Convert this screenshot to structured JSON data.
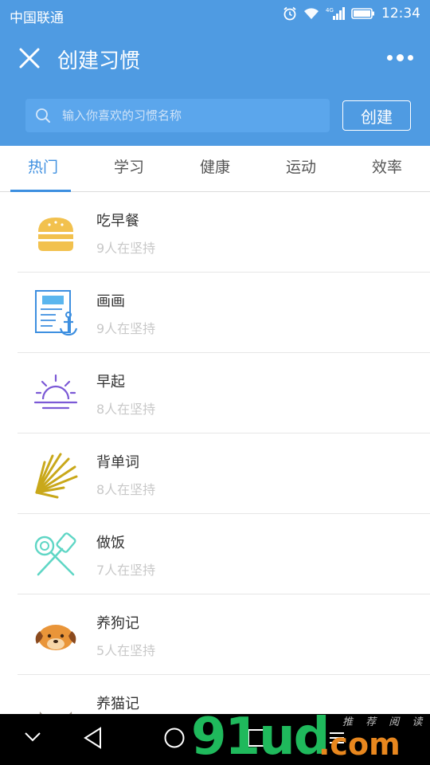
{
  "status_bar": {
    "carrier": "中国联通",
    "network": "4G",
    "time": "12:34"
  },
  "header": {
    "title": "创建习惯",
    "search_placeholder": "输入你喜欢的习惯名称",
    "create_label": "创建"
  },
  "tabs": [
    {
      "label": "热门",
      "active": true
    },
    {
      "label": "学习",
      "active": false
    },
    {
      "label": "健康",
      "active": false
    },
    {
      "label": "运动",
      "active": false
    },
    {
      "label": "效率",
      "active": false
    }
  ],
  "habits": [
    {
      "name": "吃早餐",
      "count": "9人在坚持",
      "icon": "burger-icon"
    },
    {
      "name": "画画",
      "count": "9人在坚持",
      "icon": "drawing-board-icon"
    },
    {
      "name": "早起",
      "count": "8人在坚持",
      "icon": "sunrise-icon"
    },
    {
      "name": "背单词",
      "count": "8人在坚持",
      "icon": "burst-icon"
    },
    {
      "name": "做饭",
      "count": "7人在坚持",
      "icon": "cooking-utensils-icon"
    },
    {
      "name": "养狗记",
      "count": "5人在坚持",
      "icon": "dog-icon"
    },
    {
      "name": "养猫记",
      "count": "",
      "icon": "cat-icon"
    }
  ],
  "watermark": {
    "main": "91ud",
    "suffix": ".com",
    "small": "推 荐 阅 读"
  },
  "colors": {
    "header_bg": "#4f9be2",
    "accent": "#3d8fe0",
    "muted_text": "#c8c8c8"
  }
}
